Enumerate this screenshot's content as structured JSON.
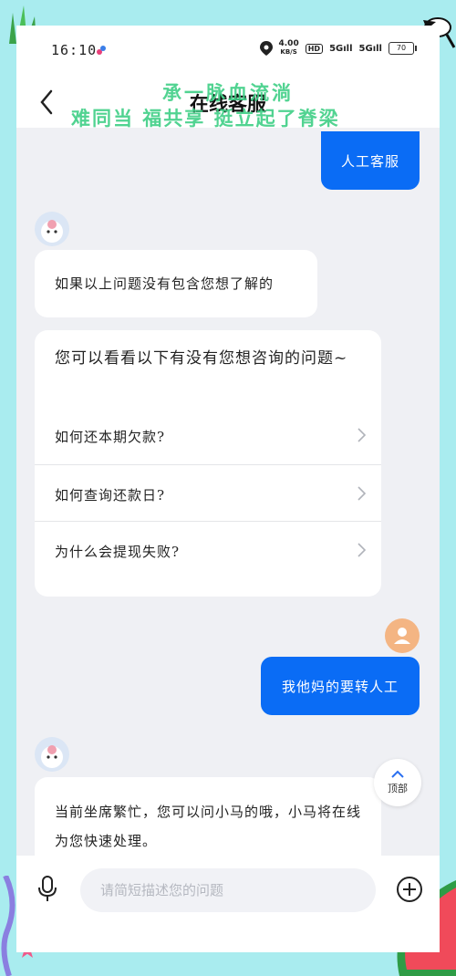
{
  "status_bar": {
    "time": "16:10",
    "net_speed_value": "4.00",
    "net_speed_unit": "KB/S",
    "hd_label": "HD",
    "signal_1": "5G",
    "signal_2": "5G",
    "battery": "70"
  },
  "header": {
    "title": "在线客服"
  },
  "overlay": {
    "line1": "承一脉血流淌",
    "line2": "难同当 福共享 挺立起了脊梁"
  },
  "chat": {
    "msg_user_1": "人工客服",
    "bot_msg_1": "如果以上问题没有包含您想了解的",
    "questions_header": "您可以看看以下有没有您想咨询的问题~",
    "questions": [
      {
        "label": "如何还本期欠款?"
      },
      {
        "label": "如何查询还款日?"
      },
      {
        "label": "为什么会提现失败?"
      }
    ],
    "msg_user_2": "我他妈的要转人工",
    "bot_msg_2": "当前坐席繁忙，您可以问小马的哦，小马将在线为您快速处理。"
  },
  "top_button": {
    "label": "顶部"
  },
  "input_bar": {
    "placeholder": "请简短描述您的问题"
  },
  "colors": {
    "accent": "#0a6cf5",
    "background": "#eff0f4",
    "frame": "#a9ecef",
    "overlay_text": "#3fcf86",
    "user_avatar": "#f4b583"
  }
}
